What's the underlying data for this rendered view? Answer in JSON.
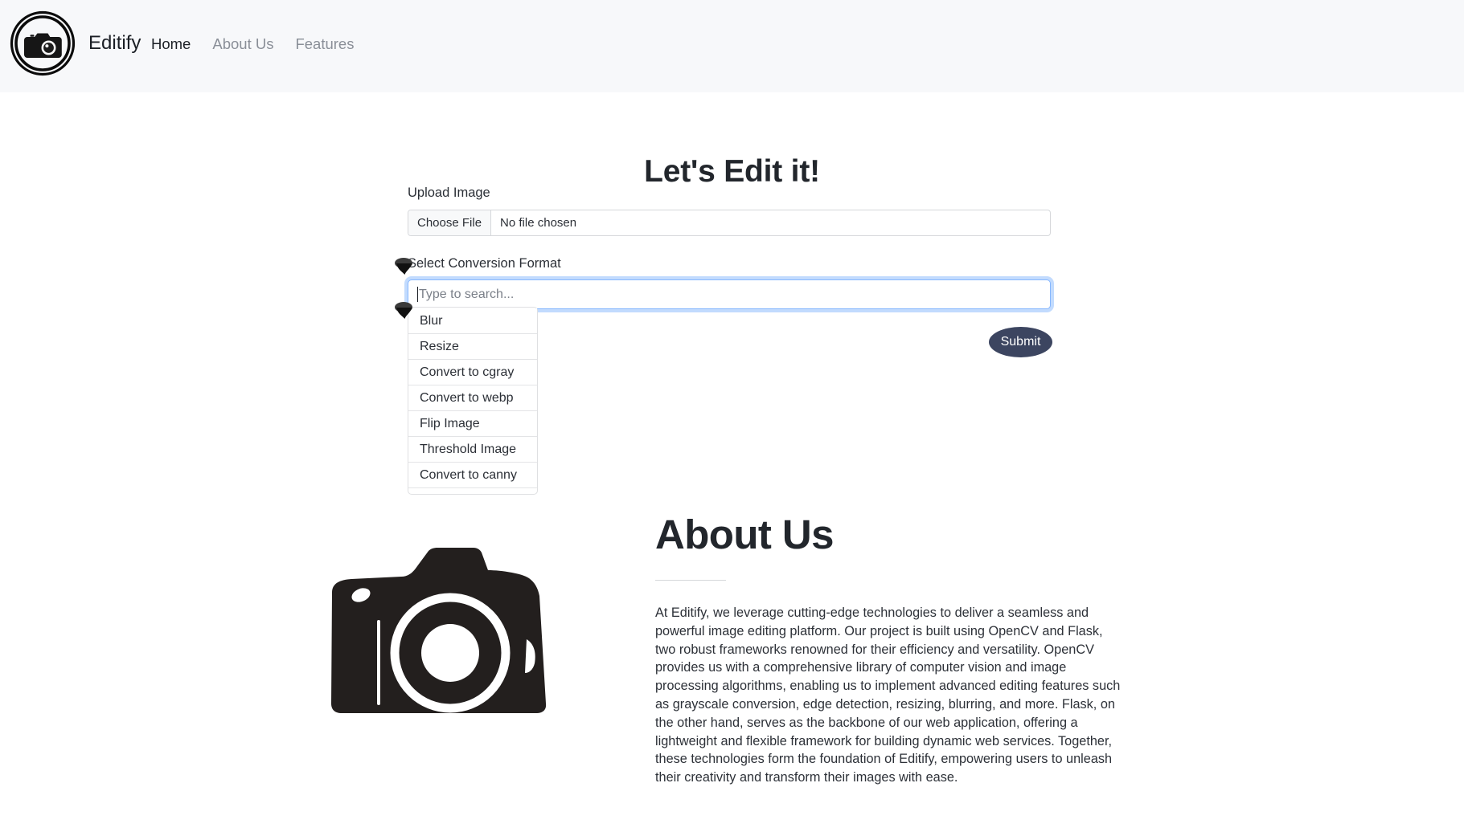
{
  "navbar": {
    "logo_icon": "camera-circle-logo",
    "brand": "Editify",
    "links": [
      {
        "label": "Home",
        "active": true
      },
      {
        "label": "About Us",
        "active": false
      },
      {
        "label": "Features",
        "active": false
      }
    ]
  },
  "main": {
    "title": "Let's Edit it!",
    "upload": {
      "label": "Upload Image",
      "button_label": "Choose File",
      "file_status": "No file chosen"
    },
    "conversion": {
      "label": "Select Conversion Format",
      "placeholder": "Type to search...",
      "value": "",
      "options": [
        "Blur",
        "Resize",
        "Convert to cgray",
        "Convert to webp",
        "Flip Image",
        "Threshold Image",
        "Convert to canny"
      ]
    },
    "submit_label": "Submit"
  },
  "about": {
    "image_icon": "camera-illustration",
    "title": "About Us",
    "body": "At Editify, we leverage cutting-edge technologies to deliver a seamless and powerful image editing platform. Our project is built using OpenCV and Flask, two robust frameworks renowned for their efficiency and versatility. OpenCV provides us with a comprehensive library of computer vision and image processing algorithms, enabling us to implement advanced editing features such as grayscale conversion, edge detection, resizing, blurring, and more. Flask, on the other hand, serves as the backbone of our web application, offering a lightweight and flexible framework for building dynamic web services. Together, these technologies form the foundation of Editify, empowering users to unleash their creativity and transform their images with ease."
  },
  "cursors": [
    {
      "name": "cursor-marker-search-field"
    },
    {
      "name": "cursor-marker-dropdown-list"
    }
  ],
  "colors": {
    "navbar_bg": "#f7f8fa",
    "accent_focus": "#86b7fe",
    "submit_bg": "#3c4560",
    "text_dark": "#22262c",
    "text_muted": "#8a8f98"
  }
}
